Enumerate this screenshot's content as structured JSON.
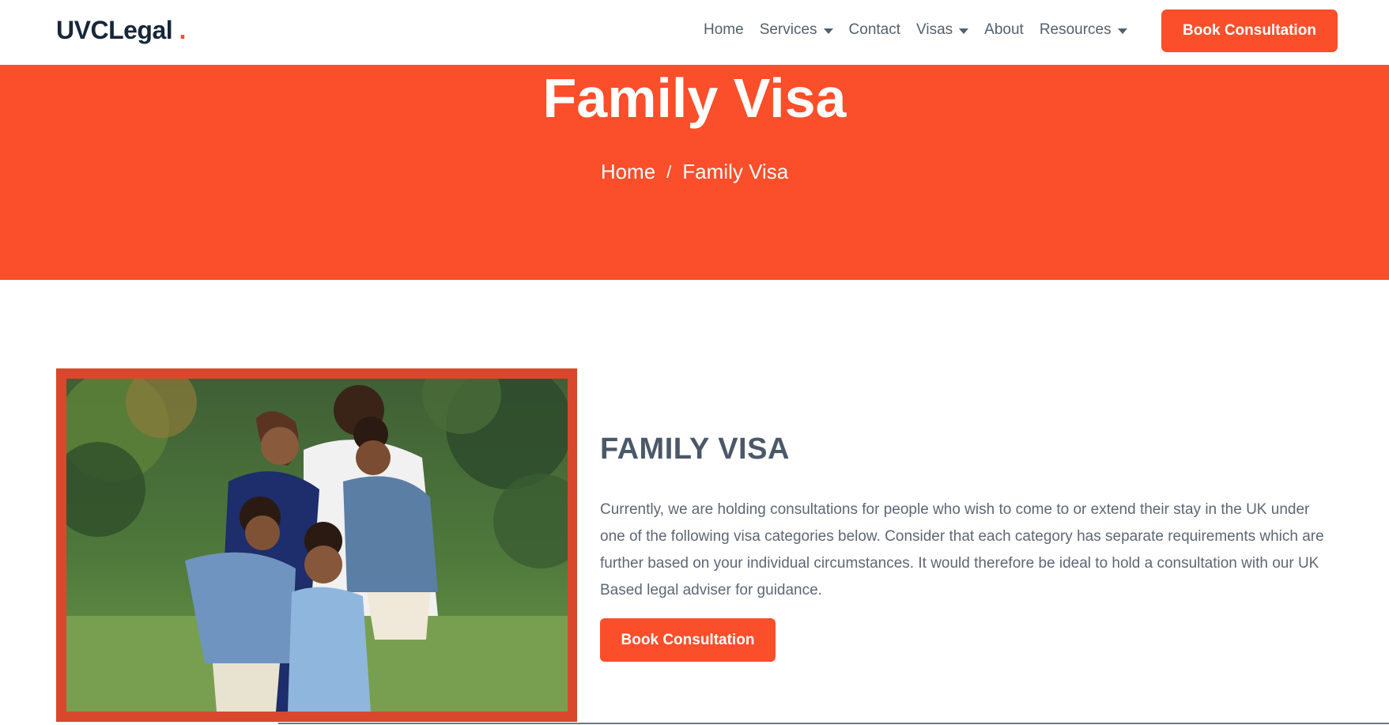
{
  "header": {
    "logo_text": "UVCLegal",
    "logo_dot": ".",
    "nav": [
      {
        "label": "Home",
        "dropdown": false
      },
      {
        "label": "Services",
        "dropdown": true
      },
      {
        "label": "Contact",
        "dropdown": false
      },
      {
        "label": "Visas",
        "dropdown": true
      },
      {
        "label": "About",
        "dropdown": false
      },
      {
        "label": "Resources",
        "dropdown": true
      }
    ],
    "cta_label": "Book Consultation"
  },
  "hero": {
    "title": "Family Visa",
    "breadcrumb": {
      "home": "Home",
      "separator": "/",
      "current": "Family Visa"
    }
  },
  "content": {
    "heading": "FAMILY VISA",
    "paragraph": "Currently, we are holding consultations for people who wish to come to or extend their stay in the UK under one of the following visa categories below. Consider that each category has separate requirements which are further based on your individual circumstances. It would therefore be ideal to hold a consultation with our UK Based legal adviser for guidance.",
    "cta_label": "Book Consultation"
  },
  "colors": {
    "accent": "#fb4e2a",
    "frame": "#d9482d",
    "logo": "#17273a",
    "heading": "#4b5869",
    "body_text": "#5d6773"
  }
}
